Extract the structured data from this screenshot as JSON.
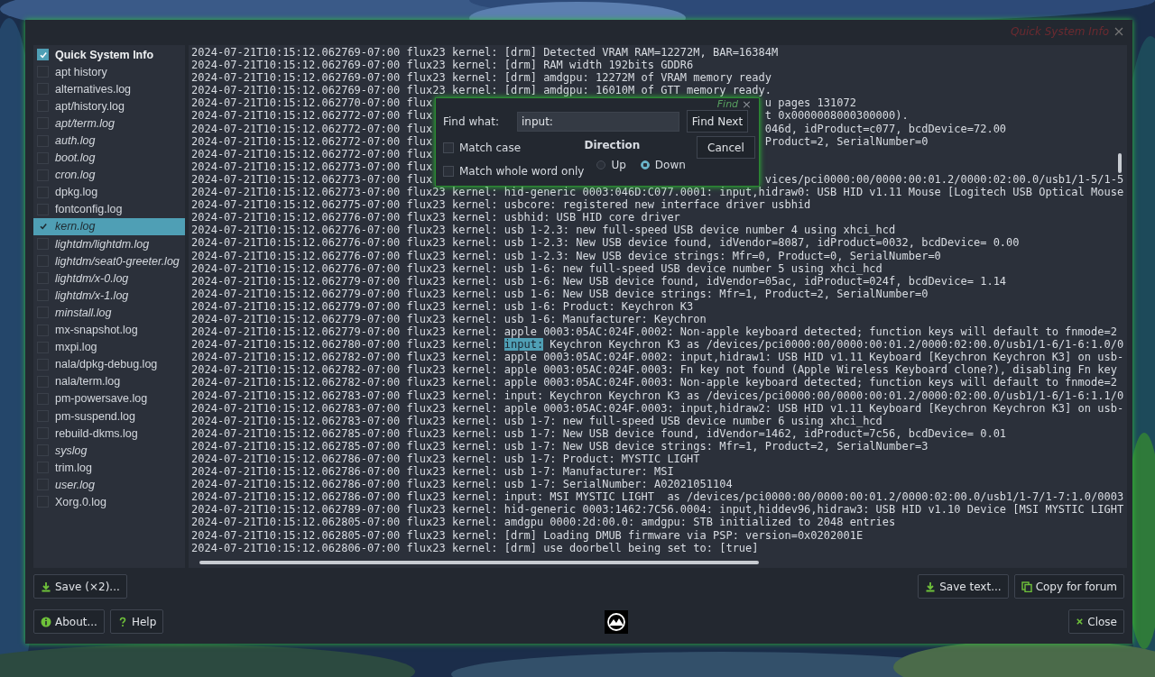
{
  "window": {
    "title": "Quick System Info"
  },
  "sidebar": {
    "items": [
      {
        "label": "Quick System Info",
        "kind": "title",
        "checked": true,
        "selected": false
      },
      {
        "label": "apt history",
        "kind": "file",
        "checked": false,
        "selected": false
      },
      {
        "label": "alternatives.log",
        "kind": "file",
        "checked": false,
        "selected": false
      },
      {
        "label": "apt/history.log",
        "kind": "file",
        "checked": false,
        "selected": false
      },
      {
        "label": "apt/term.log",
        "kind": "restricted",
        "checked": false,
        "selected": false
      },
      {
        "label": "auth.log",
        "kind": "restricted",
        "checked": false,
        "selected": false
      },
      {
        "label": "boot.log",
        "kind": "restricted",
        "checked": false,
        "selected": false
      },
      {
        "label": "cron.log",
        "kind": "restricted",
        "checked": false,
        "selected": false
      },
      {
        "label": "dpkg.log",
        "kind": "file",
        "checked": false,
        "selected": false
      },
      {
        "label": "fontconfig.log",
        "kind": "file",
        "checked": false,
        "selected": false
      },
      {
        "label": "kern.log",
        "kind": "restricted",
        "checked": true,
        "selected": true
      },
      {
        "label": "lightdm/lightdm.log",
        "kind": "restricted",
        "checked": false,
        "selected": false
      },
      {
        "label": "lightdm/seat0-greeter.log",
        "kind": "restricted",
        "checked": false,
        "selected": false
      },
      {
        "label": "lightdm/x-0.log",
        "kind": "restricted",
        "checked": false,
        "selected": false
      },
      {
        "label": "lightdm/x-1.log",
        "kind": "restricted",
        "checked": false,
        "selected": false
      },
      {
        "label": "minstall.log",
        "kind": "restricted",
        "checked": false,
        "selected": false
      },
      {
        "label": "mx-snapshot.log",
        "kind": "file",
        "checked": false,
        "selected": false
      },
      {
        "label": "mxpi.log",
        "kind": "file",
        "checked": false,
        "selected": false
      },
      {
        "label": "nala/dpkg-debug.log",
        "kind": "file",
        "checked": false,
        "selected": false
      },
      {
        "label": "nala/term.log",
        "kind": "file",
        "checked": false,
        "selected": false
      },
      {
        "label": "pm-powersave.log",
        "kind": "file",
        "checked": false,
        "selected": false
      },
      {
        "label": "pm-suspend.log",
        "kind": "file",
        "checked": false,
        "selected": false
      },
      {
        "label": "rebuild-dkms.log",
        "kind": "file",
        "checked": false,
        "selected": false
      },
      {
        "label": "syslog",
        "kind": "restricted",
        "checked": false,
        "selected": false
      },
      {
        "label": "trim.log",
        "kind": "file",
        "checked": false,
        "selected": false
      },
      {
        "label": "user.log",
        "kind": "restricted",
        "checked": false,
        "selected": false
      },
      {
        "label": "Xorg.0.log",
        "kind": "file",
        "checked": false,
        "selected": false
      }
    ]
  },
  "log": {
    "lines": [
      {
        "kind": "full",
        "text": "2024-07-21T10:15:12.062769-07:00 flux23 kernel: [drm] Detected VRAM RAM=12272M, BAR=16384M"
      },
      {
        "kind": "full",
        "text": "2024-07-21T10:15:12.062769-07:00 flux23 kernel: [drm] RAM width 192bits GDDR6"
      },
      {
        "kind": "full",
        "text": "2024-07-21T10:15:12.062769-07:00 flux23 kernel: [drm] amdgpu: 12272M of VRAM memory ready"
      },
      {
        "kind": "full",
        "text": "2024-07-21T10:15:12.062769-07:00 flux23 kernel: [drm] amdgpu: 16010M of GTT memory ready."
      },
      {
        "kind": "covered",
        "text": "2024-07-21T10:15:12.062770-07:00 flux",
        "right": "u pages 131072"
      },
      {
        "kind": "covered",
        "text": "2024-07-21T10:15:12.062772-07:00 flux",
        "right": "t 0x0000008000300000)."
      },
      {
        "kind": "covered",
        "text": "2024-07-21T10:15:12.062772-07:00 flux",
        "right": "046d, idProduct=c077, bcdDevice=72.00"
      },
      {
        "kind": "covered",
        "text": "2024-07-21T10:15:12.062772-07:00 flux",
        "right": "Product=2, SerialNumber=0"
      },
      {
        "kind": "covered",
        "text": "2024-07-21T10:15:12.062772-07:00 flux"
      },
      {
        "kind": "covered",
        "text": "2024-07-21T10:15:12.062773-07:00 flux"
      },
      {
        "kind": "covered",
        "text": "2024-07-21T10:15:12.062773-07:00 flux",
        "right": "vices/pci0000:00/0000:00:01.2/0000:02:00.0/usb1/1-5/1-5"
      },
      {
        "kind": "full",
        "text": "2024-07-21T10:15:12.062773-07:00 flux23 kernel: hid-generic 0003:046D:C077.0001: input,hidraw0: USB HID v1.11 Mouse [Logitech USB Optical Mouse"
      },
      {
        "kind": "full",
        "text": "2024-07-21T10:15:12.062775-07:00 flux23 kernel: usbcore: registered new interface driver usbhid"
      },
      {
        "kind": "full",
        "text": "2024-07-21T10:15:12.062776-07:00 flux23 kernel: usbhid: USB HID core driver"
      },
      {
        "kind": "full",
        "text": "2024-07-21T10:15:12.062776-07:00 flux23 kernel: usb 1-2.3: new full-speed USB device number 4 using xhci_hcd"
      },
      {
        "kind": "full",
        "text": "2024-07-21T10:15:12.062776-07:00 flux23 kernel: usb 1-2.3: New USB device found, idVendor=8087, idProduct=0032, bcdDevice= 0.00"
      },
      {
        "kind": "full",
        "text": "2024-07-21T10:15:12.062776-07:00 flux23 kernel: usb 1-2.3: New USB device strings: Mfr=0, Product=0, SerialNumber=0"
      },
      {
        "kind": "full",
        "text": "2024-07-21T10:15:12.062776-07:00 flux23 kernel: usb 1-6: new full-speed USB device number 5 using xhci_hcd"
      },
      {
        "kind": "full",
        "text": "2024-07-21T10:15:12.062779-07:00 flux23 kernel: usb 1-6: New USB device found, idVendor=05ac, idProduct=024f, bcdDevice= 1.14"
      },
      {
        "kind": "full",
        "text": "2024-07-21T10:15:12.062779-07:00 flux23 kernel: usb 1-6: New USB device strings: Mfr=1, Product=2, SerialNumber=0"
      },
      {
        "kind": "full",
        "text": "2024-07-21T10:15:12.062779-07:00 flux23 kernel: usb 1-6: Product: Keychron K3"
      },
      {
        "kind": "full",
        "text": "2024-07-21T10:15:12.062779-07:00 flux23 kernel: usb 1-6: Manufacturer: Keychron"
      },
      {
        "kind": "full",
        "text": "2024-07-21T10:15:12.062779-07:00 flux23 kernel: apple 0003:05AC:024F.0002: Non-apple keyboard detected; function keys will default to fnmode=2"
      },
      {
        "kind": "match",
        "text": "2024-07-21T10:15:12.062780-07:00 flux23 kernel:",
        "match": "input:",
        "after": "Keychron Keychron K3 as /devices/pci0000:00/0000:00:01.2/0000:02:00.0/usb1/1-6/1-6:1.0/0"
      },
      {
        "kind": "full",
        "text": "2024-07-21T10:15:12.062782-07:00 flux23 kernel: apple 0003:05AC:024F.0002: input,hidraw1: USB HID v1.11 Keyboard [Keychron Keychron K3] on usb-"
      },
      {
        "kind": "full",
        "text": "2024-07-21T10:15:12.062782-07:00 flux23 kernel: apple 0003:05AC:024F.0003: Fn key not found (Apple Wireless Keyboard clone?), disabling Fn key"
      },
      {
        "kind": "full",
        "text": "2024-07-21T10:15:12.062782-07:00 flux23 kernel: apple 0003:05AC:024F.0003: Non-apple keyboard detected; function keys will default to fnmode=2"
      },
      {
        "kind": "full",
        "text": "2024-07-21T10:15:12.062783-07:00 flux23 kernel: input: Keychron Keychron K3 as /devices/pci0000:00/0000:00:01.2/0000:02:00.0/usb1/1-6/1-6:1.1/0"
      },
      {
        "kind": "full",
        "text": "2024-07-21T10:15:12.062783-07:00 flux23 kernel: apple 0003:05AC:024F.0003: input,hidraw2: USB HID v1.11 Keyboard [Keychron Keychron K3] on usb-"
      },
      {
        "kind": "full",
        "text": "2024-07-21T10:15:12.062783-07:00 flux23 kernel: usb 1-7: new full-speed USB device number 6 using xhci_hcd"
      },
      {
        "kind": "full",
        "text": "2024-07-21T10:15:12.062785-07:00 flux23 kernel: usb 1-7: New USB device found, idVendor=1462, idProduct=7c56, bcdDevice= 0.01"
      },
      {
        "kind": "full",
        "text": "2024-07-21T10:15:12.062785-07:00 flux23 kernel: usb 1-7: New USB device strings: Mfr=1, Product=2, SerialNumber=3"
      },
      {
        "kind": "full",
        "text": "2024-07-21T10:15:12.062786-07:00 flux23 kernel: usb 1-7: Product: MYSTIC LIGHT"
      },
      {
        "kind": "full",
        "text": "2024-07-21T10:15:12.062786-07:00 flux23 kernel: usb 1-7: Manufacturer: MSI"
      },
      {
        "kind": "full",
        "text": "2024-07-21T10:15:12.062786-07:00 flux23 kernel: usb 1-7: SerialNumber: A02021051104"
      },
      {
        "kind": "full",
        "text": "2024-07-21T10:15:12.062786-07:00 flux23 kernel: input: MSI MYSTIC LIGHT  as /devices/pci0000:00/0000:00:01.2/0000:02:00.0/usb1/1-7/1-7:1.0/0003"
      },
      {
        "kind": "full",
        "text": "2024-07-21T10:15:12.062789-07:00 flux23 kernel: hid-generic 0003:1462:7C56.0004: input,hiddev96,hidraw3: USB HID v1.10 Device [MSI MYSTIC LIGHT"
      },
      {
        "kind": "full",
        "text": "2024-07-21T10:15:12.062805-07:00 flux23 kernel: amdgpu 0000:2d:00.0: amdgpu: STB initialized to 2048 entries"
      },
      {
        "kind": "full",
        "text": "2024-07-21T10:15:12.062805-07:00 flux23 kernel: [drm] Loading DMUB firmware via PSP: version=0x0202001E"
      },
      {
        "kind": "full",
        "text": "2024-07-21T10:15:12.062806-07:00 flux23 kernel: [drm] use doorbell being set to: [true]"
      }
    ]
  },
  "find_dialog": {
    "title": "Find",
    "close": "×",
    "find_label": "Find what:",
    "find_value": "input:",
    "find_next": "Find Next",
    "cancel": "Cancel",
    "options": [
      {
        "label": "Match case",
        "checked": false
      },
      {
        "label": "Match whole word only",
        "checked": false
      }
    ],
    "direction": {
      "label": "Direction",
      "options": [
        {
          "label": "Up",
          "selected": false
        },
        {
          "label": "Down",
          "selected": true
        }
      ]
    }
  },
  "buttons": {
    "save": "Save (×2)...",
    "save_text": "Save text...",
    "copy": "Copy for forum",
    "about": "About...",
    "help": "Help",
    "close": "Close"
  }
}
